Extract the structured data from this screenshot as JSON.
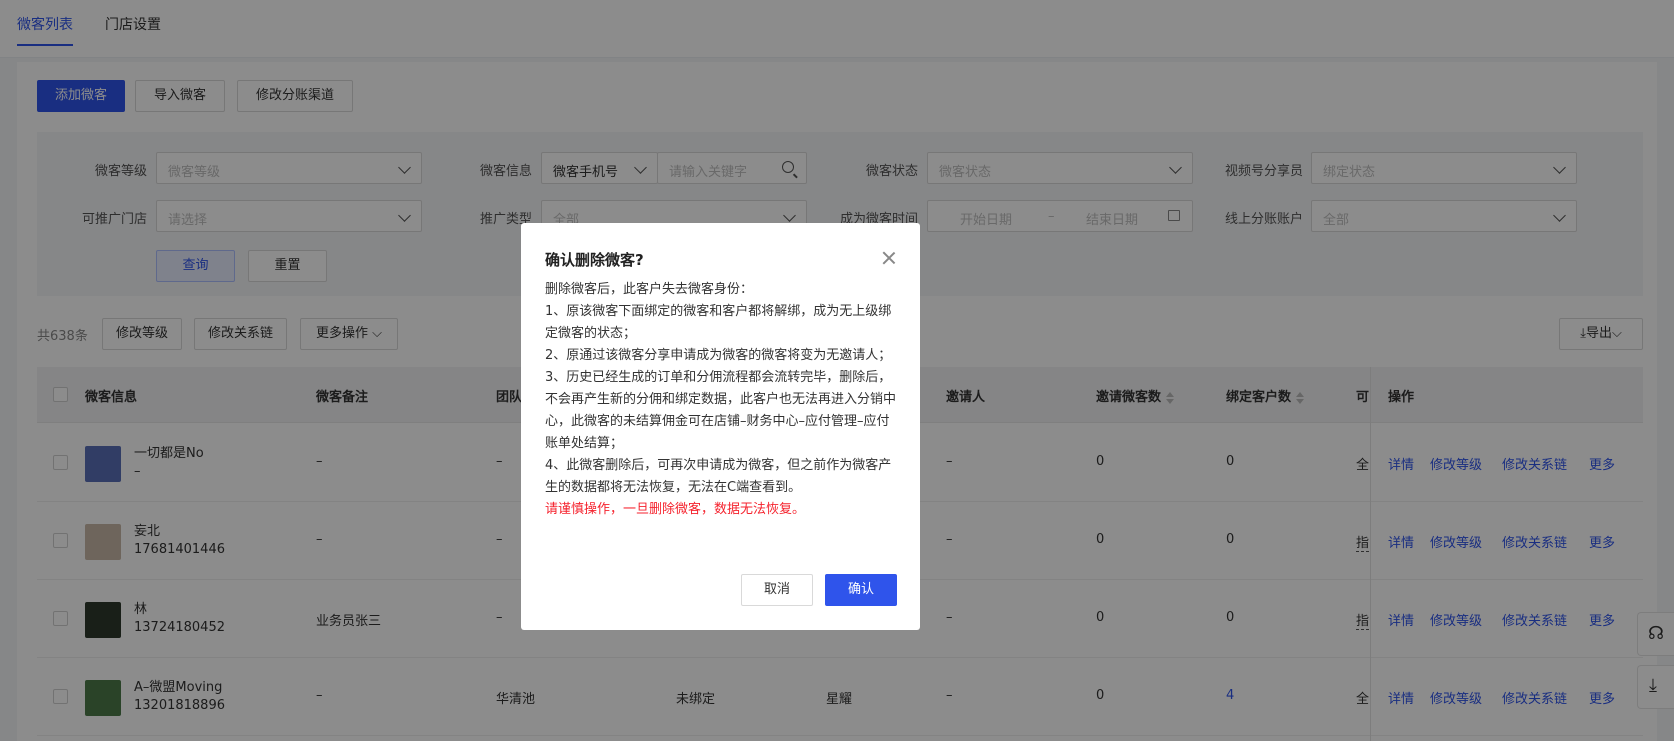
{
  "tabs": [
    {
      "label": "微客列表",
      "active": true
    },
    {
      "label": "门店设置",
      "active": false
    }
  ],
  "actions": {
    "add": "添加微客",
    "import": "导入微客",
    "channel": "修改分账渠道"
  },
  "filters": {
    "level_label": "微客等级",
    "level_ph": "微客等级",
    "info_label": "微客信息",
    "info_type": "微客手机号",
    "info_ph": "请输入关键字",
    "status_label": "微客状态",
    "status_ph": "微客状态",
    "video_label": "视频号分享员",
    "video_ph": "绑定状态",
    "store_label": "可推广门店",
    "store_ph": "请选择",
    "promo_label": "推广类型",
    "promo_val": "全部",
    "time_label": "成为微客时间",
    "start_ph": "开始日期",
    "dash": "–",
    "end_ph": "结束日期",
    "account_label": "线上分账账户",
    "account_val": "全部",
    "query": "查询",
    "reset": "重置"
  },
  "toolbar": {
    "total": "共638条",
    "edit_level": "修改等级",
    "edit_chain": "修改关系链",
    "more_ops": "更多操作",
    "export": "导出"
  },
  "table": {
    "headers": {
      "info": "微客信息",
      "remark": "微客备注",
      "team": "团队",
      "inviter": "邀请人",
      "invite_count": "邀请微客数",
      "bind_count": "绑定客户数",
      "store_short": "可",
      "ops": "操作"
    },
    "rows": [
      {
        "name": "一切都是No",
        "phone": "–",
        "remark": "–",
        "team": "–",
        "bind": "",
        "level": "",
        "inviter": "–",
        "invite_count": "0",
        "bind_count": "0",
        "store": "全",
        "avatar_color": "#5a6fb8"
      },
      {
        "name": "妄北",
        "phone": "17681401446",
        "remark": "–",
        "team": "–",
        "bind": "",
        "level": "",
        "inviter": "–",
        "invite_count": "0",
        "bind_count": "0",
        "store": "指",
        "avatar_color": "#c8b9a8"
      },
      {
        "name": "林",
        "phone": "13724180452",
        "remark": "业务员张三",
        "team": "–",
        "bind": "",
        "level": "",
        "inviter": "–",
        "invite_count": "0",
        "bind_count": "0",
        "store": "指",
        "avatar_color": "#2e3a2c"
      },
      {
        "name": "A–微盟Moving",
        "phone": "13201818896",
        "remark": "–",
        "team": "华清池",
        "bind": "未绑定",
        "level": "星耀",
        "inviter": "–",
        "invite_count": "0",
        "bind_count": "4",
        "store": "全",
        "avatar_color": "#4d7a4a"
      }
    ],
    "row_ops": {
      "detail": "详情",
      "edit_level": "修改等级",
      "edit_chain": "修改关系链",
      "more": "更多"
    }
  },
  "modal": {
    "title": "确认删除微客?",
    "lines": [
      "删除微客后，此客户失去微客身份：",
      "1、原该微客下面绑定的微客和客户都将解绑，成为无上级绑定微客的状态；",
      "2、原通过该微客分享申请成为微客的微客将变为无邀请人；",
      "3、历史已经生成的订单和分佣流程都会流转完毕，删除后，不会再产生新的分佣和绑定数据，此客户也无法再进入分销中心，此微客的未结算佣金可在店铺–财务中心–应付管理–应付账单处结算；",
      "4、此微客删除后，可再次申请成为微客，但之前作为微客产生的数据都将无法恢复，无法在C端查看到。"
    ],
    "warning": "请谨慎操作，一旦删除微客，数据无法恢复。",
    "cancel": "取消",
    "confirm": "确认"
  },
  "colors": {
    "accent": "#2f54eb",
    "warning": "#f5222d"
  }
}
